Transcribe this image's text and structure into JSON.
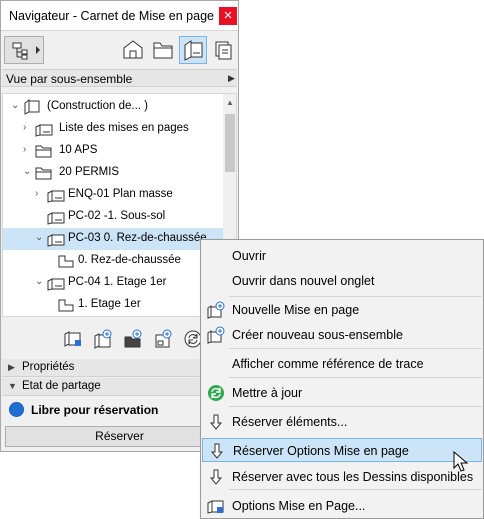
{
  "window": {
    "title": "Navigateur - Carnet de Mise en page",
    "close_glyph": "×"
  },
  "view_selector": {
    "label": "Vue par sous-ensemble"
  },
  "tree": [
    {
      "label": "(Construction de... )",
      "expander": "⌄",
      "icon": "book-icon"
    },
    {
      "label": "Liste des mises en pages",
      "expander": "›",
      "icon": "layout-icon"
    },
    {
      "label": "10 APS",
      "expander": "›",
      "icon": "folder-icon"
    },
    {
      "label": "20 PERMIS",
      "expander": "⌄",
      "icon": "folder-icon"
    },
    {
      "label": "ENQ-01 Plan masse",
      "expander": "›",
      "icon": "layout-icon"
    },
    {
      "label": "PC-02 -1. Sous-sol",
      "expander": "",
      "icon": "layout-icon"
    },
    {
      "label": "PC-03 0. Rez-de-chaussée",
      "expander": "⌄",
      "icon": "layout-icon",
      "selected": true
    },
    {
      "label": "0. Rez-de-chaussée",
      "expander": "",
      "icon": "drawing-icon"
    },
    {
      "label": "PC-04 1. Etage 1er",
      "expander": "⌄",
      "icon": "layout-icon"
    },
    {
      "label": "1. Etage 1er",
      "expander": "",
      "icon": "drawing-icon"
    }
  ],
  "sections": {
    "properties": "Propriétés",
    "sharing": "Etat de partage"
  },
  "status": {
    "label": "Libre pour réservation",
    "color": "#1f6fd6"
  },
  "reserve_button": "Réserver",
  "context_menu": {
    "items": [
      {
        "label": "Ouvrir",
        "icon": ""
      },
      {
        "label": "Ouvrir dans nouvel onglet",
        "icon": ""
      },
      {
        "label": "Nouvelle Mise en page",
        "icon": "new-layout-icon"
      },
      {
        "label": "Créer nouveau sous-ensemble",
        "icon": "new-subset-icon"
      },
      {
        "label": "Afficher comme référence de trace",
        "icon": ""
      },
      {
        "label": "Mettre à jour",
        "icon": "refresh-icon"
      },
      {
        "label": "Réserver éléments...",
        "icon": "reserve-arrow-icon"
      },
      {
        "label": "Réserver Options Mise en page",
        "icon": "reserve-arrow-icon",
        "highlighted": true
      },
      {
        "label": "Réserver avec tous les Dessins disponibles",
        "icon": "reserve-arrow-icon"
      },
      {
        "label": "Options Mise en Page...",
        "icon": "layout-options-icon"
      }
    ]
  },
  "colors": {
    "selection": "#cce4f7",
    "selection_border": "#78b4e6",
    "close": "#e81123"
  }
}
